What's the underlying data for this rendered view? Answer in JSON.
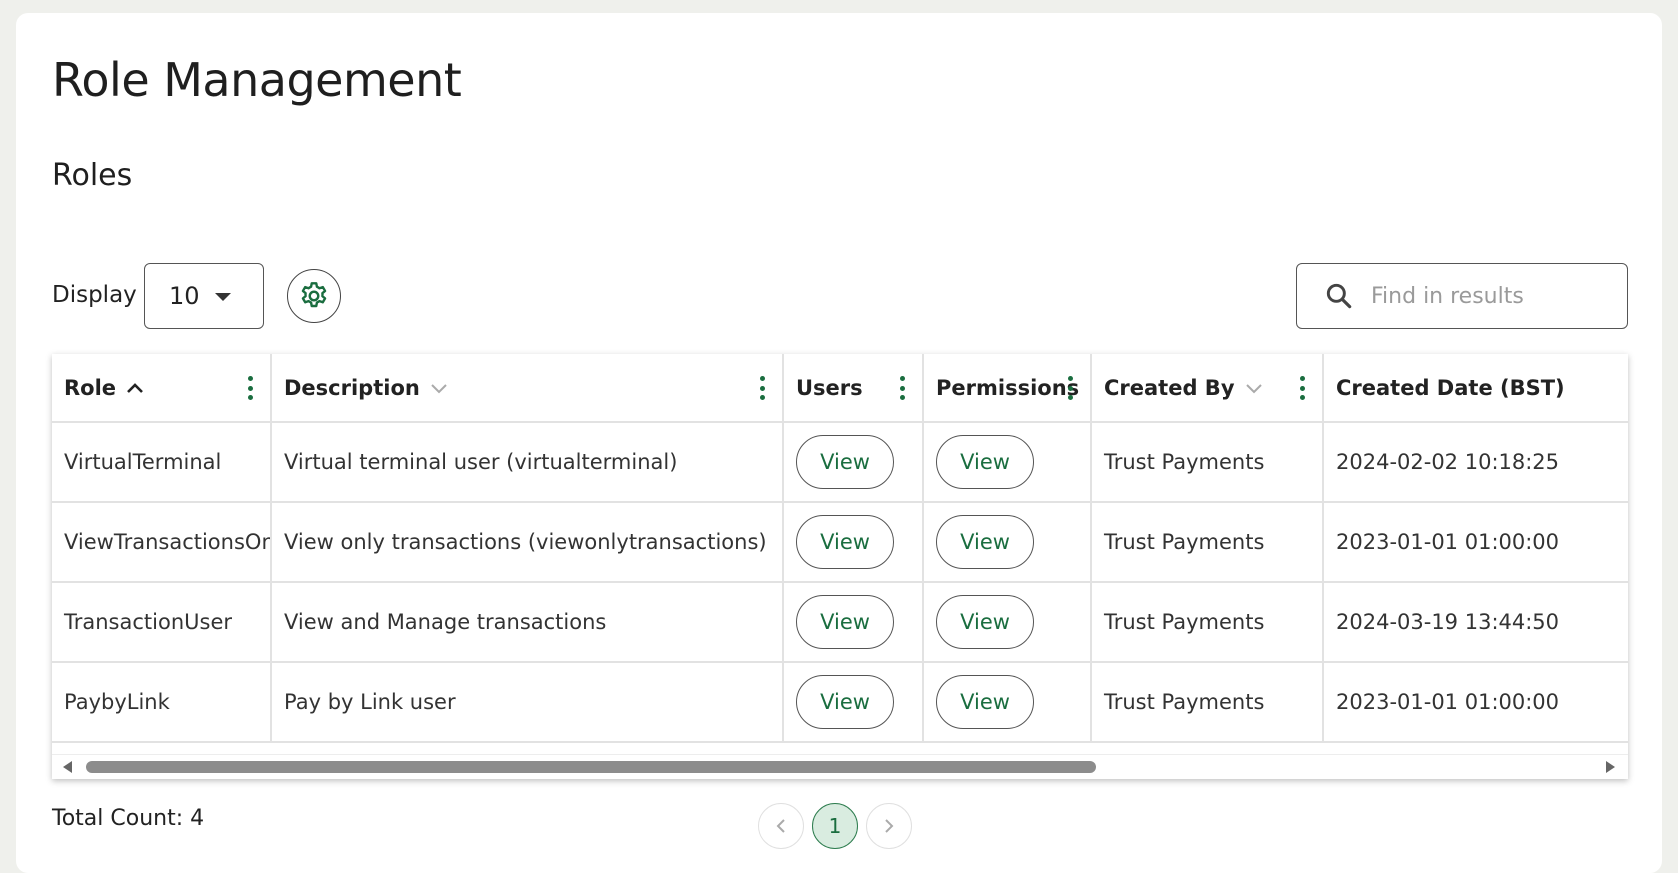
{
  "page": {
    "title": "Role Management",
    "section_title": "Roles"
  },
  "toolbar": {
    "display_label": "Display",
    "page_size": "10",
    "settings_icon": "gear-icon",
    "search": {
      "placeholder": "Find in results",
      "value": "",
      "icon": "search-icon"
    }
  },
  "table": {
    "columns": [
      {
        "label": "Role",
        "sort": "ascending"
      },
      {
        "label": "Description",
        "sort": "sortable"
      },
      {
        "label": "Users",
        "sort": "none"
      },
      {
        "label": "Permissions",
        "sort": "none"
      },
      {
        "label": "Created By",
        "sort": "sortable"
      },
      {
        "label": "Created Date (BST)",
        "sort": "none"
      }
    ],
    "view_label": "View",
    "rows": [
      {
        "role": "VirtualTerminal",
        "description": "Virtual terminal user (virtualterminal)",
        "created_by": "Trust Payments",
        "created_date": "2024-02-02 10:18:25"
      },
      {
        "role": "ViewTransactionsOnly",
        "description": "View only transactions (viewonlytransactions)",
        "created_by": "Trust Payments",
        "created_date": "2023-01-01 01:00:00"
      },
      {
        "role": "TransactionUser",
        "description": "View and Manage transactions",
        "created_by": "Trust Payments",
        "created_date": "2024-03-19 13:44:50"
      },
      {
        "role": "PaybyLink",
        "description": "Pay by Link user",
        "created_by": "Trust Payments",
        "created_date": "2023-01-01 01:00:00"
      }
    ]
  },
  "footer": {
    "total_count_label": "Total Count: 4",
    "current_page": "1"
  },
  "colors": {
    "accent": "#1a6d3f",
    "active_page_bg": "#d9ece0",
    "background": "#eff0ec"
  }
}
